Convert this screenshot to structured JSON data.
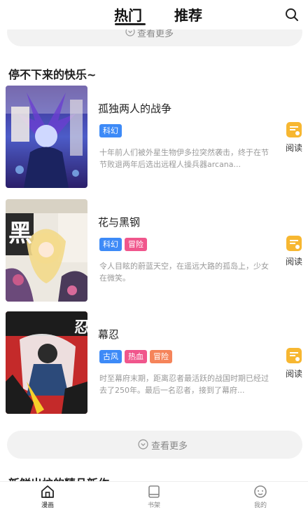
{
  "header": {
    "tabs": [
      {
        "label": "热门",
        "active": true
      },
      {
        "label": "推荐",
        "active": false
      }
    ],
    "search_icon": "search-icon"
  },
  "top_more": {
    "label": "查看更多"
  },
  "section": {
    "title": "停不下来的快乐~"
  },
  "comics": [
    {
      "title": "孤独两人的战争",
      "tags": [
        {
          "label": "科幻",
          "color": "#3d8af7"
        }
      ],
      "description": "十年前人们被外星生物伊多拉突然袭击，终于在节节败退两年后选出远程人操兵器arcana...",
      "read_label": "阅读"
    },
    {
      "title": "花与黑钢",
      "tags": [
        {
          "label": "科幻",
          "color": "#3d8af7"
        },
        {
          "label": "冒险",
          "color": "#f0568c"
        }
      ],
      "description": "令人目眩的蔚蓝天空，在遥远大路的孤岛上，少女在微笑。",
      "read_label": "阅读"
    },
    {
      "title": "幕忍",
      "tags": [
        {
          "label": "古风",
          "color": "#3d8af7"
        },
        {
          "label": "热血",
          "color": "#f0568c"
        },
        {
          "label": "冒险",
          "color": "#f5845a"
        }
      ],
      "description": "时至幕府末期，距离忍者最活跃的战国时期已经过去了250年。最后一名忍者，接到了幕府...",
      "read_label": "阅读"
    }
  ],
  "bottom_more": {
    "label": "查看更多"
  },
  "next_section": {
    "title": "新鲜出炉的精品新作"
  },
  "nav": [
    {
      "label": "漫画",
      "icon": "home-icon",
      "active": true
    },
    {
      "label": "书架",
      "icon": "bookshelf-icon",
      "active": false
    },
    {
      "label": "我的",
      "icon": "profile-icon",
      "active": false
    }
  ],
  "colors": {
    "accent_read": "#f7b731",
    "tag_blue": "#3d8af7",
    "tag_pink": "#f0568c",
    "tag_orange": "#f5845a"
  }
}
